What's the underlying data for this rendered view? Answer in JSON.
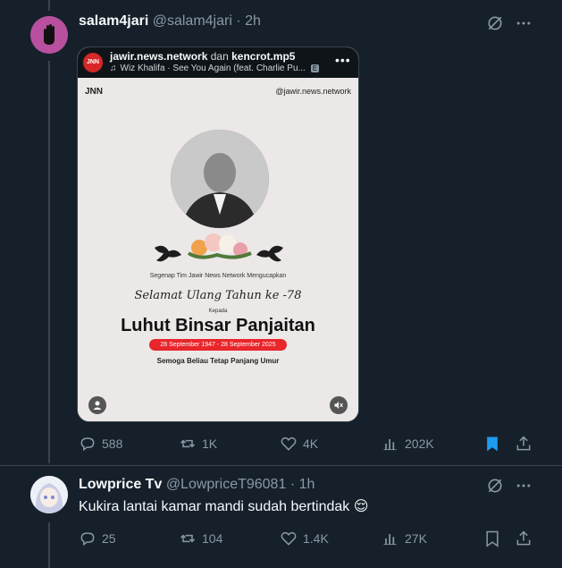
{
  "tweet1": {
    "author_name": "salam4jari",
    "handle": "@salam4jari",
    "sep": "·",
    "time": "2h",
    "card": {
      "account": "jawir.news.network",
      "joiner": "dan",
      "account2": "kencrot.mp5",
      "music": "Wiz Khalifa · See You Again (feat. Charlie Pu...",
      "explicit_badge": "E",
      "poster": {
        "logo": "JNN",
        "watermark": "@jawir.news.network",
        "line1": "Segenap Tim Jawir News Network Mengucapkan",
        "script_line": "Selamat Ulang Tahun ke -78",
        "kepada": "Kepada",
        "honoree": "Luhut Binsar Panjaitan",
        "dates": "28 September 1947 - 28 September 2025",
        "wish": "Semoga Beliau Tetap Panjang Umur"
      }
    },
    "stats": {
      "replies": "588",
      "reposts": "1K",
      "likes": "4K",
      "views": "202K"
    }
  },
  "tweet2": {
    "author_name": "Lowprice Tv",
    "handle": "@LowpriceT96081",
    "sep": "·",
    "time": "1h",
    "text": "Kukira lantai kamar mandi sudah bertindak",
    "emoji": "😌",
    "stats": {
      "replies": "25",
      "reposts": "104",
      "likes": "1.4K",
      "views": "27K"
    }
  },
  "colors": {
    "background": "#15202b",
    "text_secondary": "#8b98a5",
    "accent": "#1d9bf0",
    "dates_banner": "#e8262b"
  }
}
